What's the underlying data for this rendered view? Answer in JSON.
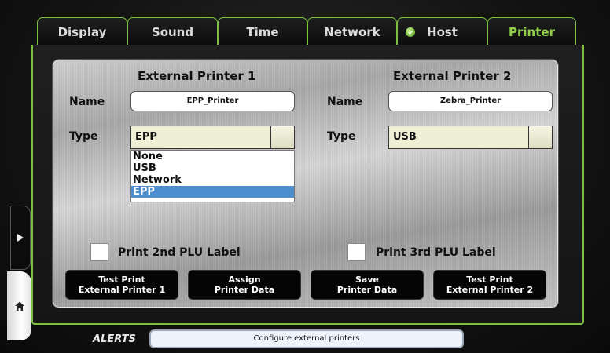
{
  "tabs": [
    {
      "label": "Display"
    },
    {
      "label": "Sound"
    },
    {
      "label": "Time"
    },
    {
      "label": "Network"
    },
    {
      "label": "Host",
      "status_icon": "check-circle-icon"
    },
    {
      "label": "Printer",
      "active": true
    }
  ],
  "printer1": {
    "header": "External Printer 1",
    "name_label": "Name",
    "name_value": "EPP_Printer",
    "type_label": "Type",
    "type_value": "EPP",
    "type_options": [
      "None",
      "USB",
      "Network",
      "EPP"
    ],
    "selected_option": "EPP"
  },
  "printer2": {
    "header": "External Printer 2",
    "name_label": "Name",
    "name_value": "Zebra_Printer",
    "type_label": "Type",
    "type_value": "USB"
  },
  "checkboxes": {
    "plu2": {
      "label": "Print 2nd PLU Label",
      "checked": false
    },
    "plu3": {
      "label": "Print 3rd PLU Label",
      "checked": false
    }
  },
  "buttons": {
    "test1": {
      "line1": "Test Print",
      "line2": "External Printer 1"
    },
    "assign": {
      "line1": "Assign",
      "line2": "Printer Data"
    },
    "save": {
      "line1": "Save",
      "line2": "Printer Data"
    },
    "test2": {
      "line1": "Test Print",
      "line2": "External Printer 2"
    }
  },
  "alerts": {
    "label": "ALERTS",
    "message": "Configure external printers"
  },
  "colors": {
    "accent_green": "#7cbf40",
    "active_tab_text": "#93d14a",
    "selected_option_bg": "#4d8fce"
  }
}
